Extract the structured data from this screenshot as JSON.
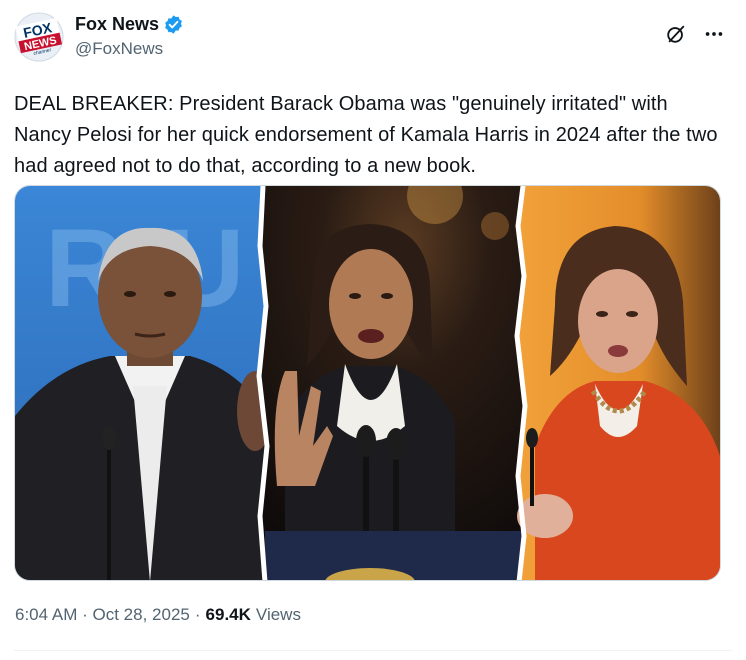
{
  "author": {
    "display_name": "Fox News",
    "handle": "@FoxNews",
    "verified": true,
    "avatar_text_top": "FOX",
    "avatar_text_bottom": "NEWS",
    "avatar_text_small": "channel"
  },
  "header_icons": [
    "grok-icon",
    "more-icon"
  ],
  "tweet": {
    "text": "DEAL BREAKER: President Barack Obama was \"genuinely irritated\" with Nancy Pelosi for her quick endorsement of Kamala Harris in 2024 after the two had agreed not to do that, according to a new book."
  },
  "media": {
    "panels": [
      "left-portrait",
      "center-portrait",
      "right-portrait"
    ]
  },
  "meta": {
    "time": "6:04 AM",
    "separator": "·",
    "date": "Oct 28, 2025",
    "views_count": "69.4K",
    "views_label": "Views"
  },
  "colors": {
    "text": "#0f1419",
    "secondary": "#536471",
    "verified": "#1d9bf0",
    "brand_red": "#c8102e",
    "brand_blue": "#003366"
  }
}
